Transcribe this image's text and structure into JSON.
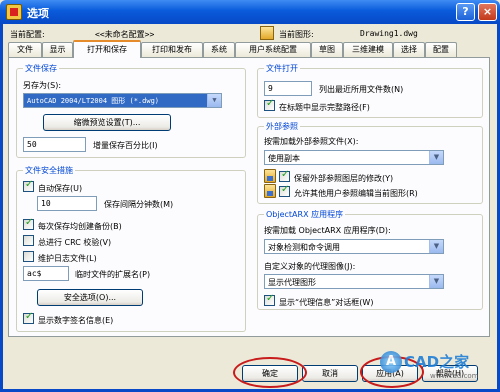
{
  "window": {
    "title": "选项"
  },
  "titlebar": {
    "help": "?",
    "close": "×"
  },
  "profile": {
    "label": "当前配置:",
    "value": "<<未命名配置>>"
  },
  "drawing": {
    "label": "当前图形:",
    "value": "Drawing1.dwg"
  },
  "tabs": [
    "文件",
    "显示",
    "打开和保存",
    "打印和发布",
    "系统",
    "用户系统配置",
    "草图",
    "三维建模",
    "选择",
    "配置"
  ],
  "file_save": {
    "title": "文件保存",
    "save_as_label": "另存为(S):",
    "save_as_value": "AutoCAD 2004/LT2004 图形 (*.dwg)",
    "thumbnail_button": "缩微预览设置(T)...",
    "incremental_value": "50",
    "incremental_label": "增量保存百分比(I)"
  },
  "file_safety": {
    "title": "文件安全措施",
    "autosave_label": "自动保存(U)",
    "autosave_minutes": "10",
    "minutes_label": "保存间隔分钟数(M)",
    "backup_label": "每次保存均创建备份(B)",
    "crc_label": "总进行 CRC 校验(V)",
    "log_label": "维护日志文件(L)",
    "temp_ext_value": "ac$",
    "temp_ext_label": "临时文件的扩展名(P)",
    "security_button": "安全选项(O)...",
    "digital_sig_label": "显示数字签名信息(E)"
  },
  "file_open": {
    "title": "文件打开",
    "recent_value": "9",
    "recent_label": "列出最近所用文件数(N)",
    "fullpath_label": "在标题中显示完整路径(F)"
  },
  "xref": {
    "title": "外部参照",
    "demand_label": "按需加载外部参照文件(X):",
    "demand_value": "使用副本",
    "retain_label": "保留外部参照图层的修改(Y)",
    "allow_edit_label": "允许其他用户参照编辑当前图形(R)"
  },
  "objectarx": {
    "title": "ObjectARX 应用程序",
    "demand_label": "按需加载 ObjectARX 应用程序(D):",
    "demand_value": "对象检测和命令调用",
    "proxy_label": "自定义对象的代理图像(J):",
    "proxy_value": "显示代理图形",
    "proxy_info_label": "显示“代理信息”对话框(W)"
  },
  "buttons": {
    "ok": "确定",
    "cancel": "取消",
    "apply": "应用(A)",
    "help": "帮助(H)"
  },
  "watermark": {
    "text": "CAD之家",
    "url": "www.cad.com"
  },
  "colors": {
    "title_bar": "#0a5bdb",
    "group_title": "#0046d5",
    "annotation": "#c81b1b",
    "tab_highlight": "#e68b2c"
  }
}
